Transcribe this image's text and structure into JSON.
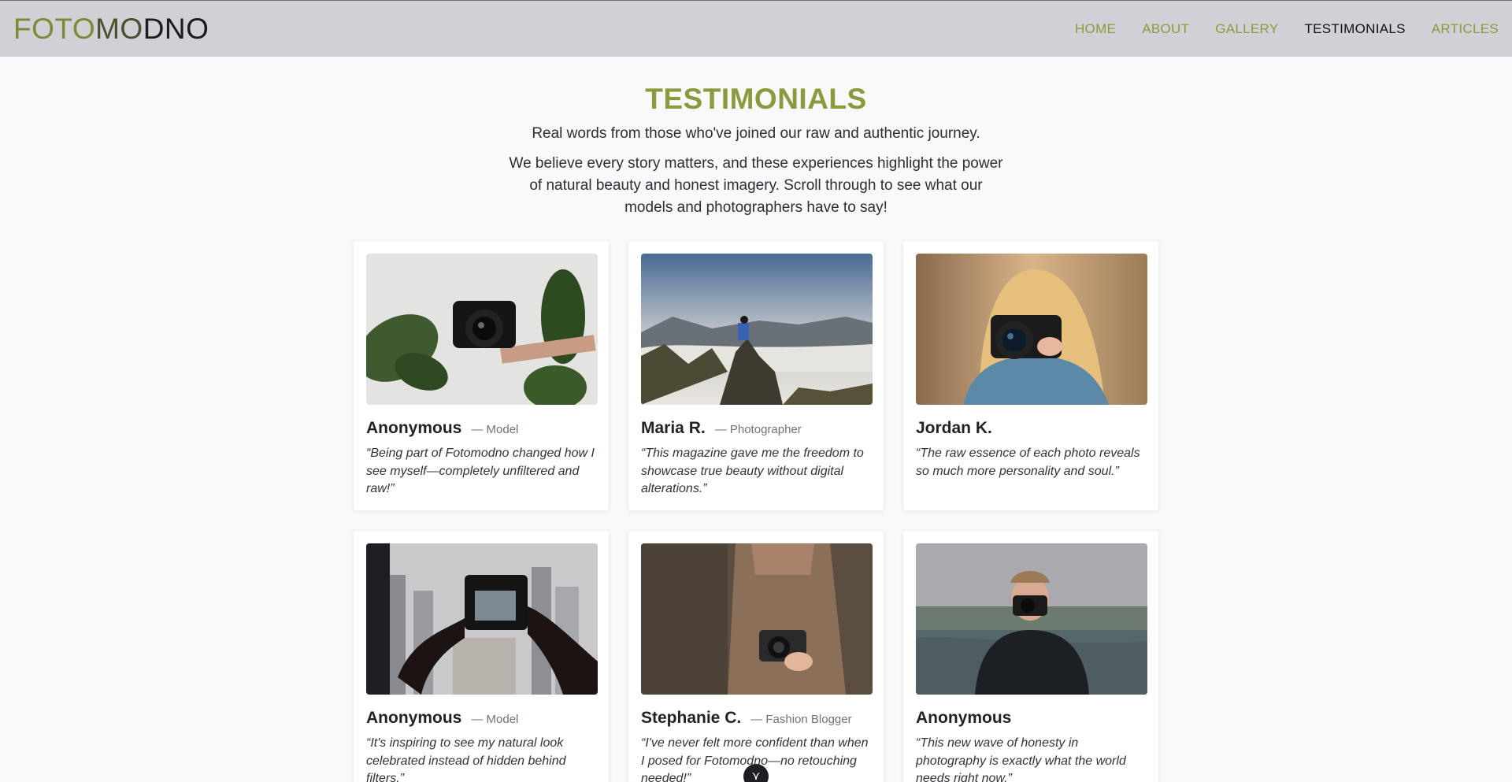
{
  "brand": {
    "part1": "FOTO",
    "part2": "MO",
    "part3": "DNO"
  },
  "nav": [
    {
      "label": "HOME",
      "active": false
    },
    {
      "label": "ABOUT",
      "active": false
    },
    {
      "label": "GALLERY",
      "active": false
    },
    {
      "label": "TESTIMONIALS",
      "active": true
    },
    {
      "label": "ARTICLES",
      "active": false
    }
  ],
  "hero": {
    "title": "TESTIMONIALS",
    "lead": "Real words from those who've joined our raw and authentic journey.",
    "description": "We believe every story matters, and these experiences highlight the power of natural beauty and honest imagery. Scroll through to see what our models and photographers have to say!"
  },
  "testimonials": [
    {
      "name": "Anonymous",
      "role": "— Model",
      "quote": "“Being part of Fotomodno changed how I see myself—completely unfiltered and raw!”",
      "photo": "woman-holding-camera-with-plant"
    },
    {
      "name": "Maria R.",
      "role": "— Photographer",
      "quote": "“This magazine gave me the freedom to showcase true beauty without digital alterations.”",
      "photo": "photographer-on-mountain-above-clouds"
    },
    {
      "name": "Jordan K.",
      "role": "",
      "quote": "“The raw essence of each photo reveals so much more personality and soul.”",
      "photo": "blonde-woman-with-camera"
    },
    {
      "name": "Anonymous",
      "role": "— Model",
      "quote": "“It's inspiring to see my natural look celebrated instead of hidden behind filters.”",
      "photo": "hands-holding-camera-city-view"
    },
    {
      "name": "Stephanie C.",
      "role": "— Fashion Blogger",
      "quote": "“I've never felt more confident than when I posed for Fotomodno—no retouching needed!”",
      "photo": "person-in-sweater-with-camera"
    },
    {
      "name": "Anonymous",
      "role": "",
      "quote": "“This new wave of honesty in photography is exactly what the world needs right now.”",
      "photo": "man-with-camera-by-sea"
    }
  ],
  "scroll_button": {
    "icon": "chevron-down-icon",
    "glyph": "⋎"
  },
  "colors": {
    "accent": "#8a9b3d",
    "navbar": "#d0d0d6",
    "background": "#f8f9fa"
  }
}
